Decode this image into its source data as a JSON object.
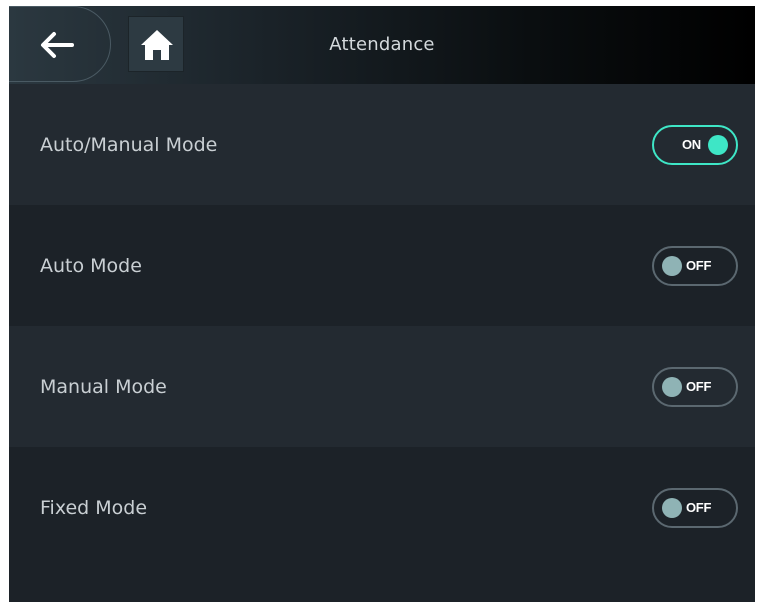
{
  "header": {
    "title": "Attendance",
    "back_icon": "arrow-left-icon",
    "home_icon": "home-icon"
  },
  "settings": [
    {
      "label": "Auto/Manual Mode",
      "state": "ON"
    },
    {
      "label": "Auto Mode",
      "state": "OFF"
    },
    {
      "label": "Manual Mode",
      "state": "OFF"
    },
    {
      "label": "Fixed Mode",
      "state": "OFF"
    }
  ],
  "colors": {
    "accent_on": "#3ee6c6",
    "knob_off": "#8fb3b5",
    "background": "#1f262d"
  }
}
